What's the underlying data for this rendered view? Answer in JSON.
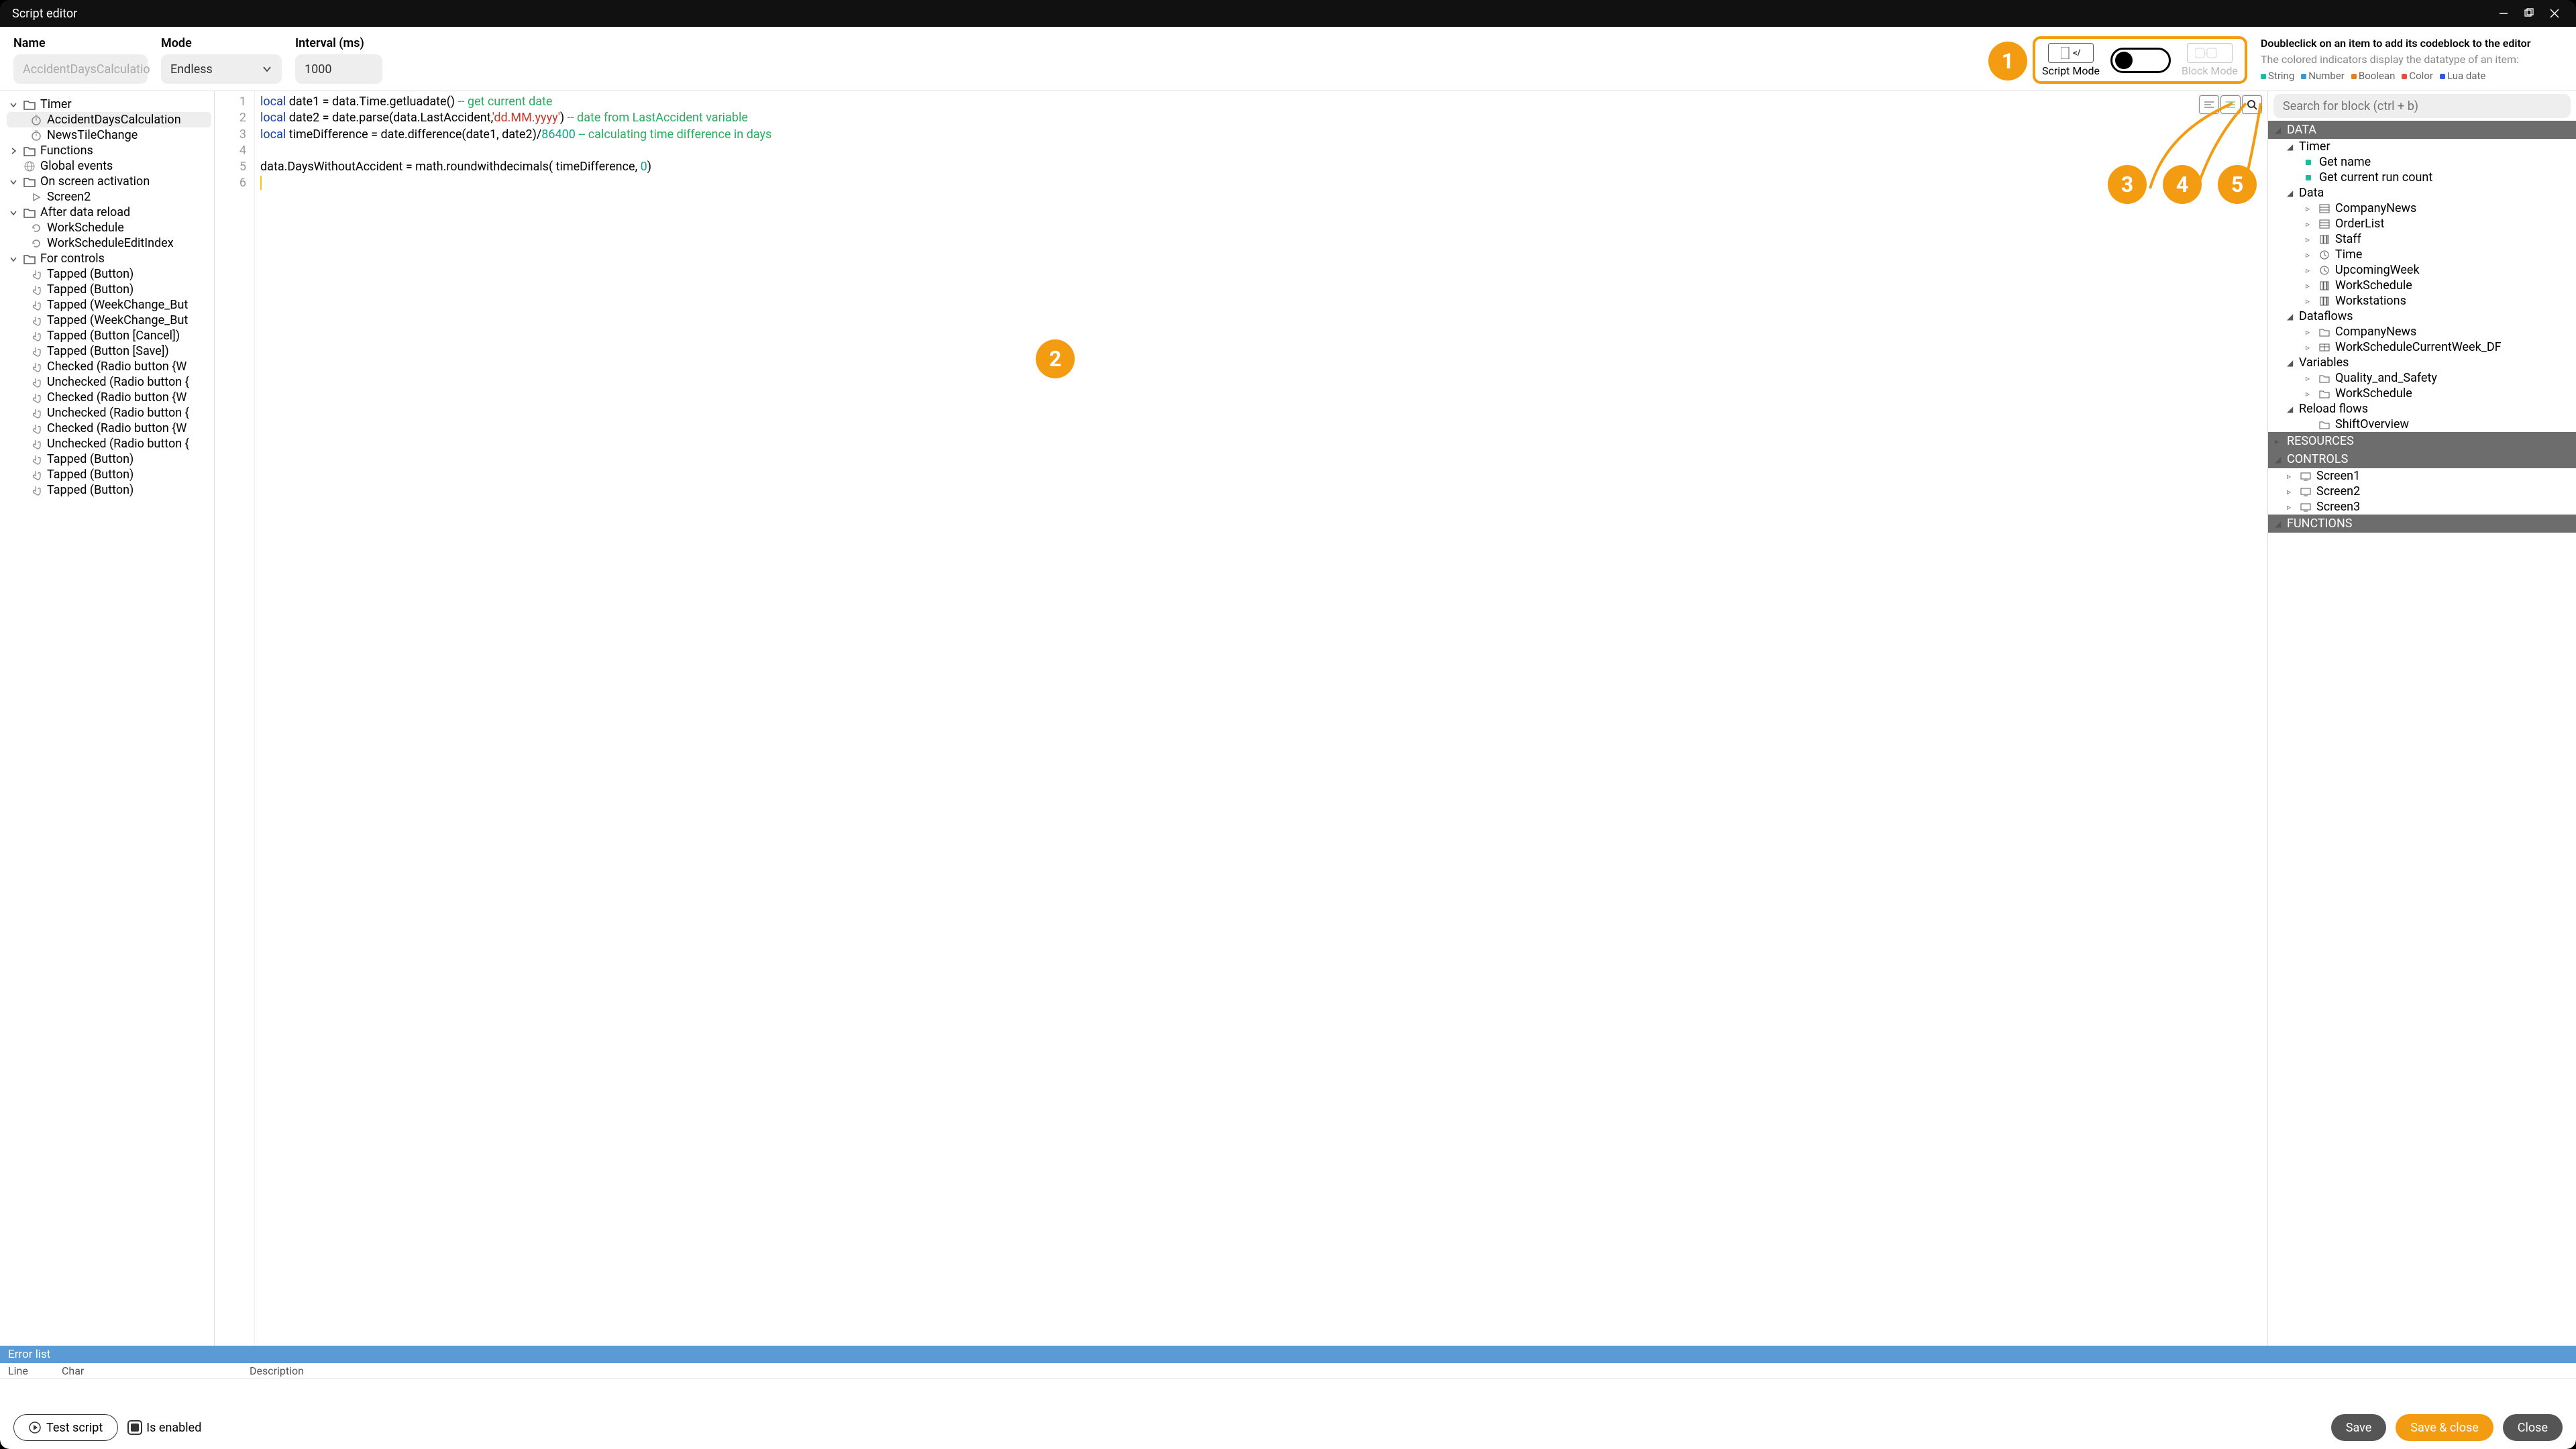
{
  "window": {
    "title": "Script editor"
  },
  "fields": {
    "name_label": "Name",
    "name_placeholder": "AccidentDaysCalculatio",
    "mode_label": "Mode",
    "mode_value": "Endless",
    "interval_label": "Interval (ms)",
    "interval_value": "1000"
  },
  "modetoggle": {
    "script_label": "Script Mode",
    "block_label": "Block Mode"
  },
  "help": {
    "line1": "Doubleclick on an item to add its codeblock to the editor",
    "line2": "The colored indicators display the datatype of an item:",
    "legend": [
      {
        "label": "String",
        "color": "#1abc9c"
      },
      {
        "label": "Number",
        "color": "#3498db"
      },
      {
        "label": "Boolean",
        "color": "#e67e22"
      },
      {
        "label": "Color",
        "color": "#e74c3c"
      },
      {
        "label": "Lua date",
        "color": "#2e5bd8"
      }
    ]
  },
  "callouts": {
    "c1": "1",
    "c2": "2",
    "c3": "3",
    "c4": "4",
    "c5": "5"
  },
  "lefttree": {
    "timer": [
      "AccidentDaysCalculation",
      "NewsTileChange"
    ],
    "functions": "Functions",
    "globalevents": "Global events",
    "on_screen": "On screen activation",
    "on_screen_items": [
      "Screen2"
    ],
    "after_reload": "After data reload",
    "after_reload_items": [
      "WorkSchedule",
      "WorkScheduleEditIndex"
    ],
    "for_controls": "For controls",
    "for_controls_items": [
      "Tapped (Button)",
      "Tapped (Button)",
      "Tapped (WeekChange_But",
      "Tapped (WeekChange_But",
      "Tapped (Button [Cancel])",
      "Tapped (Button [Save])",
      "Checked (Radio button {W",
      "Unchecked (Radio button {",
      "Checked (Radio button {W",
      "Unchecked (Radio button {",
      "Checked (Radio button {W",
      "Unchecked (Radio button {",
      "Tapped (Button)",
      "Tapped (Button)",
      "Tapped (Button)"
    ],
    "labels": {
      "timer": "Timer"
    }
  },
  "code_lines": [
    "1",
    "2",
    "3",
    "4",
    "5",
    "6"
  ],
  "search_placeholder": "Search for block (ctrl + b)",
  "rightpanel": {
    "section_data": "DATA",
    "section_resources": "RESOURCES",
    "section_controls": "CONTROLS",
    "section_functions": "FUNCTIONS",
    "timer": {
      "label": "Timer",
      "items": [
        "Get name",
        "Get current run count"
      ]
    },
    "data": {
      "label": "Data",
      "items": [
        "CompanyNews",
        "OrderList",
        "Staff",
        "Time",
        "UpcomingWeek",
        "WorkSchedule",
        "Workstations"
      ]
    },
    "dataflows": {
      "label": "Dataflows",
      "items": [
        "CompanyNews",
        "WorkScheduleCurrentWeek_DF"
      ]
    },
    "variables": {
      "label": "Variables",
      "items": [
        "Quality_and_Safety",
        "WorkSchedule"
      ]
    },
    "reloadflows": {
      "label": "Reload flows",
      "items": [
        "ShiftOverview"
      ]
    },
    "controls_items": [
      "Screen1",
      "Screen2",
      "Screen3"
    ]
  },
  "errorlist": {
    "title": "Error list",
    "col_line": "Line",
    "col_char": "Char",
    "col_desc": "Description"
  },
  "footer": {
    "test": "Test script",
    "enabled": "Is enabled",
    "save": "Save",
    "saveclose": "Save & close",
    "close": "Close"
  }
}
